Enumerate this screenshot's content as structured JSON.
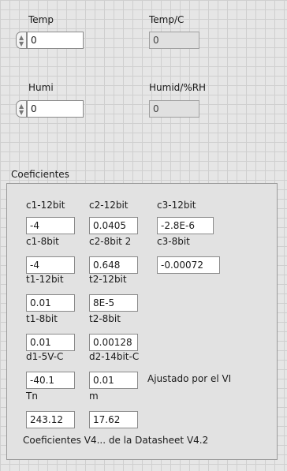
{
  "temp": {
    "label": "Temp",
    "value": "0"
  },
  "temp_c": {
    "label": "Temp/C",
    "value": "0"
  },
  "humi": {
    "label": "Humi",
    "value": "0"
  },
  "humid_rh": {
    "label": "Humid/%RH",
    "value": "0"
  },
  "coef": {
    "title": "Coeficientes",
    "c1_12bit": {
      "label": "c1-12bit",
      "value": "-4"
    },
    "c2_12bit": {
      "label": "c2-12bit",
      "value": "0.0405"
    },
    "c3_12bit": {
      "label": "c3-12bit",
      "value": "-2.8E-6"
    },
    "c1_8bit": {
      "label": "c1-8bit",
      "value": "-4"
    },
    "c2_8bit": {
      "label": "c2-8bit 2",
      "value": "0.648"
    },
    "c3_8bit": {
      "label": "c3-8bit",
      "value": "-0.00072"
    },
    "t1_12bit": {
      "label": "t1-12bit",
      "value": "0.01"
    },
    "t2_12bit": {
      "label": "t2-12bit",
      "value": "8E-5"
    },
    "t1_8bit": {
      "label": "t1-8bit",
      "value": "0.01"
    },
    "t2_8bit": {
      "label": "t2-8bit",
      "value": "0.00128"
    },
    "d1": {
      "label": "d1-5V-C",
      "value": "-40.1"
    },
    "d2": {
      "label": "d2-14bit-C",
      "value": "0.01"
    },
    "ajustado": "Ajustado por el VI",
    "tn": {
      "label": "Tn",
      "value": "243.12"
    },
    "m": {
      "label": "m",
      "value": "17.62"
    },
    "note": "Coeficientes V4... de la Datasheet V4.2"
  }
}
